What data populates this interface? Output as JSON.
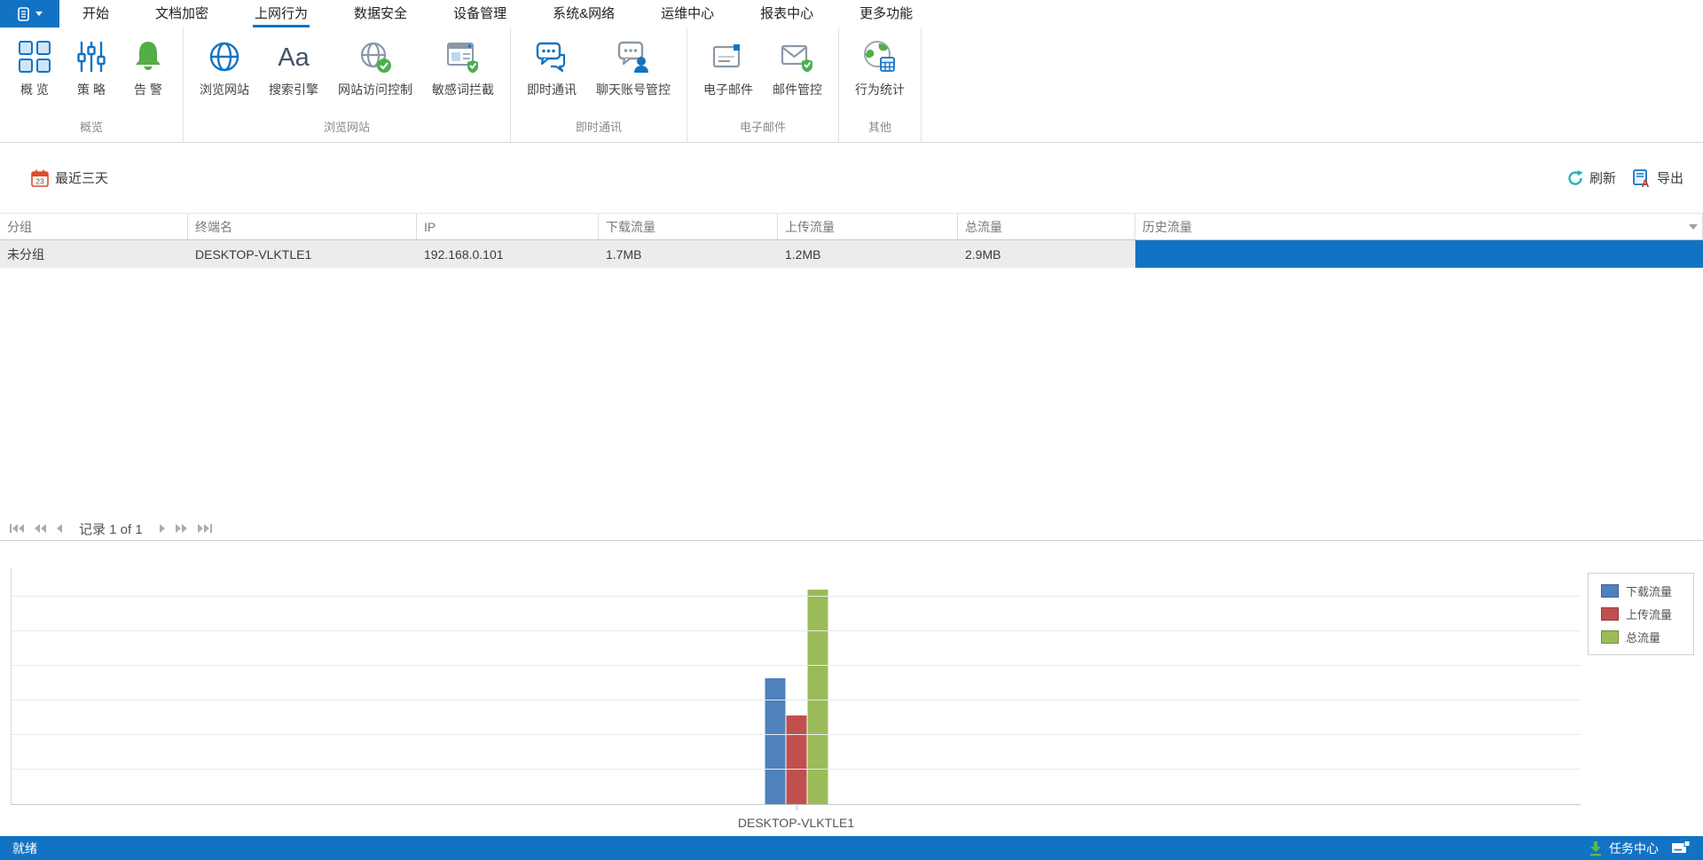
{
  "menu": {
    "tabs": [
      {
        "label": "开始",
        "active": false
      },
      {
        "label": "文档加密",
        "active": false
      },
      {
        "label": "上网行为",
        "active": true
      },
      {
        "label": "数据安全",
        "active": false
      },
      {
        "label": "设备管理",
        "active": false
      },
      {
        "label": "系统&网络",
        "active": false
      },
      {
        "label": "运维中心",
        "active": false
      },
      {
        "label": "报表中心",
        "active": false
      },
      {
        "label": "更多功能",
        "active": false
      }
    ]
  },
  "ribbon": {
    "groups": [
      {
        "label": "概览",
        "items": [
          {
            "label": "概 览",
            "icon": "overview-icon"
          },
          {
            "label": "策 略",
            "icon": "policy-icon"
          },
          {
            "label": "告 警",
            "icon": "alert-icon"
          }
        ]
      },
      {
        "label": "浏览网站",
        "items": [
          {
            "label": "浏览网站",
            "icon": "browse-website-icon"
          },
          {
            "label": "搜索引擎",
            "icon": "search-engine-icon"
          },
          {
            "label": "网站访问控制",
            "icon": "website-access-control-icon"
          },
          {
            "label": "敏感词拦截",
            "icon": "sensitive-word-block-icon"
          }
        ]
      },
      {
        "label": "即时通讯",
        "items": [
          {
            "label": "即时通讯",
            "icon": "instant-messaging-icon"
          },
          {
            "label": "聊天账号管控",
            "icon": "chat-account-control-icon"
          }
        ]
      },
      {
        "label": "电子邮件",
        "items": [
          {
            "label": "电子邮件",
            "icon": "email-icon"
          },
          {
            "label": "邮件管控",
            "icon": "mail-control-icon"
          }
        ]
      },
      {
        "label": "其他",
        "items": [
          {
            "label": "行为统计",
            "icon": "behavior-stats-icon"
          }
        ]
      }
    ]
  },
  "toolbar": {
    "date_filter_label": "最近三天",
    "calendar_day": "23",
    "refresh_label": "刷新",
    "export_label": "导出"
  },
  "table": {
    "columns": [
      "分组",
      "终端名",
      "IP",
      "下载流量",
      "上传流量",
      "总流量",
      "历史流量"
    ],
    "rows": [
      {
        "group": "未分组",
        "terminal": "DESKTOP-VLKTLE1",
        "ip": "192.168.0.101",
        "download": "1.7MB",
        "upload": "1.2MB",
        "total": "2.9MB"
      }
    ],
    "history_bar_color": "#1273C4"
  },
  "pagination": {
    "label": "记录 1 of 1"
  },
  "chart_data": {
    "type": "bar",
    "categories": [
      "DESKTOP-VLKTLE1"
    ],
    "series": [
      {
        "name": "下载流量",
        "values": [
          1.7
        ],
        "color": "#4F81BD"
      },
      {
        "name": "上传流量",
        "values": [
          1.2
        ],
        "color": "#C0504D"
      },
      {
        "name": "总流量",
        "values": [
          2.9
        ],
        "color": "#9BBB59"
      }
    ],
    "unit": "MB",
    "ylim": [
      0,
      3.2
    ],
    "grid": true,
    "y_tick_labels_visible": false,
    "legend_position": "top-right"
  },
  "status_bar": {
    "ready_label": "就绪",
    "task_center_label": "任务中心"
  },
  "colors": {
    "accent": "#1273C4",
    "alert_green": "#55AD47",
    "refresh_teal": "#2AB0B8",
    "calendar_red": "#E04A2F",
    "row_bg": "#ECECEC"
  }
}
